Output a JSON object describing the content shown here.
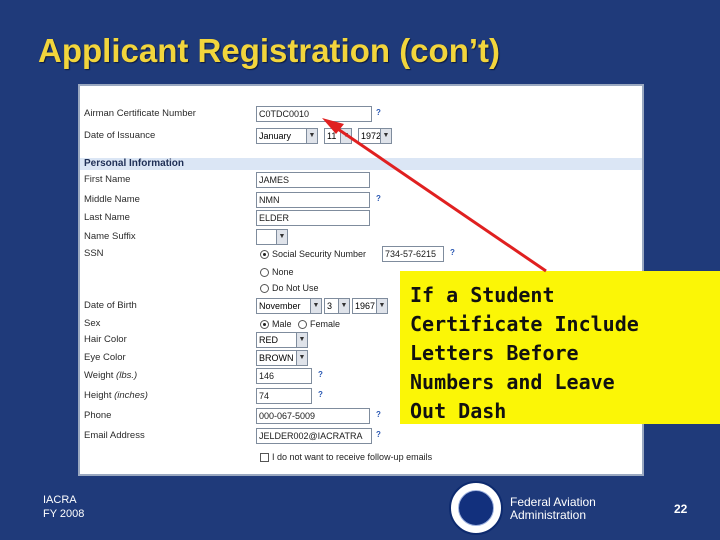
{
  "slide": {
    "title": "Applicant Registration (con’t)",
    "footer_left_line1": "IACRA",
    "footer_left_line2": "FY 2008",
    "footer_agency_line1": "Federal Aviation",
    "footer_agency_line2": "Administration",
    "page_number": "22"
  },
  "form": {
    "airman_cert_label": "Airman Certificate Number",
    "airman_cert_value": "C0TDC0010",
    "issuance_label": "Date of Issuance",
    "issuance_month": "January",
    "issuance_day": "11",
    "issuance_year": "1972",
    "section_personal": "Personal Information",
    "first_name_label": "First Name",
    "first_name_value": "JAMES",
    "middle_name_label": "Middle Name",
    "middle_name_value": "NMN",
    "last_name_label": "Last Name",
    "last_name_value": "ELDER",
    "suffix_label": "Name Suffix",
    "suffix_value": "",
    "ssn_label": "SSN",
    "ssn_option_ssn": "Social Security Number",
    "ssn_value": "734-57-6215",
    "ssn_option_none": "None",
    "ssn_option_dnu": "Do Not Use",
    "dob_label": "Date of Birth",
    "dob_month": "November",
    "dob_day": "3",
    "dob_year": "1967",
    "sex_label": "Sex",
    "sex_male": "Male",
    "sex_female": "Female",
    "hair_label": "Hair Color",
    "hair_value": "RED",
    "eye_label": "Eye Color",
    "eye_value": "BROWN",
    "weight_label": "Weight",
    "weight_unit": "(lbs.)",
    "weight_value": "146",
    "height_label": "Height",
    "height_unit": "(inches)",
    "height_value": "74",
    "phone_label": "Phone",
    "phone_value": "000-067-5009",
    "email_label": "Email Address",
    "email_value": "JELDER002@IACRATRA",
    "followup_label": "I do not want to receive follow-up emails"
  },
  "callout": {
    "lines": [
      "If a Student",
      "Certificate Include",
      "Letters Before",
      "Numbers and Leave",
      "Out Dash"
    ]
  },
  "colors": {
    "background": "#1f3a7a",
    "title": "#f2d53c",
    "callout": "#fbf606",
    "arrow": "#e02020"
  }
}
